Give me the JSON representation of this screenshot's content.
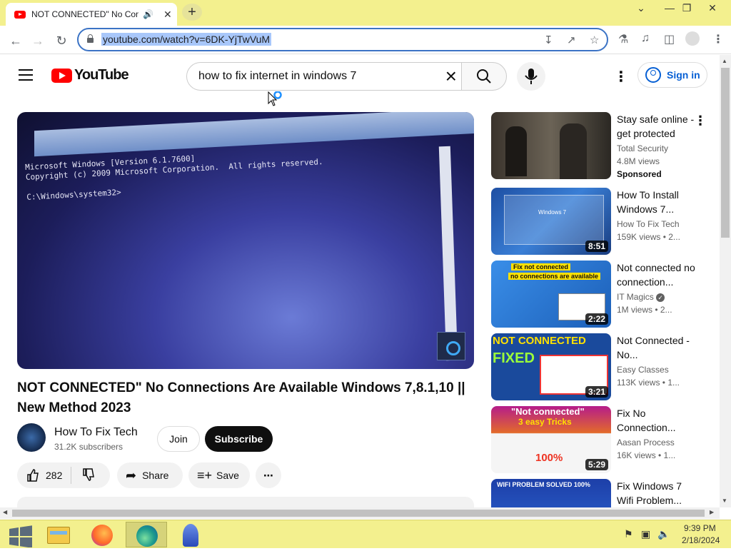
{
  "browser": {
    "tab_title": "NOT CONNECTED\" No Con",
    "new_tab_label": "+",
    "url": "youtube.com/watch?v=6DK-YjTwVuM",
    "window_controls": [
      "chevron-down",
      "minimize",
      "restore",
      "close"
    ]
  },
  "youtube": {
    "logo_text": "YouTube",
    "search_query": "how to fix internet in windows 7",
    "sign_in_label": "Sign in"
  },
  "video": {
    "cmd_lines": "Microsoft Windows [Version 6.1.7600]\nCopyright (c) 2009 Microsoft Corporation.  All rights reserved.\n\nC:\\Windows\\system32>",
    "title": "NOT CONNECTED\" No Connections Are Available Windows 7,8.1,10 || New Method 2023",
    "channel_name": "How To Fix Tech",
    "subscribers": "31.2K subscribers",
    "join_label": "Join",
    "subscribe_label": "Subscribe",
    "likes": "282",
    "share_label": "Share",
    "save_label": "Save"
  },
  "recommendations": [
    {
      "title": "Stay safe online - get protected",
      "channel": "Total Security",
      "views": "4.8M views",
      "sponsored": "Sponsored",
      "duration": ""
    },
    {
      "title": "How To Install Windows 7...",
      "channel": "How To Fix Tech",
      "views": "159K views  • 2...",
      "duration": "8:51"
    },
    {
      "title": "Not connected no connection...",
      "channel": "IT Magics",
      "views": "1M views  • 2...",
      "duration": "2:22"
    },
    {
      "title": "Not Connected - No...",
      "channel": "Easy Classes",
      "views": "113K views  • 1...",
      "duration": "3:21"
    },
    {
      "title": "Fix No Connection...",
      "channel": "Aasan Process",
      "views": "16K views  • 1...",
      "duration": "5:29"
    },
    {
      "title": "Fix Windows 7 Wifi Problem...",
      "channel": "",
      "views": "",
      "duration": ""
    }
  ],
  "thumb_texts": {
    "t2_line1": "Fix not connected",
    "t2_line2": "no connections are available",
    "t3_line1": "NOT CONNECTED",
    "t3_line2": "FIXED",
    "t4_line1": "\"Not connected\"",
    "t4_line2": "3 easy Tricks",
    "t4_pct": "100%",
    "t5_line1": "WIFI PROBLEM SOLVED 100%",
    "win7_text": "Windows 7"
  },
  "taskbar": {
    "time": "9:39 PM",
    "date": "2/18/2024"
  },
  "colors": {
    "chrome_frame": "#f3f08e",
    "yt_red": "#ff0000",
    "link_blue": "#065fd4"
  }
}
